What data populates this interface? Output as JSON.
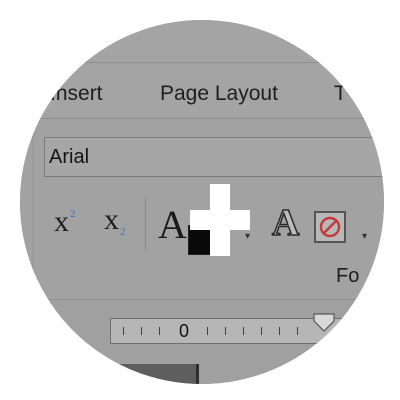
{
  "tabs": {
    "insert": "Insert",
    "page_layout": "Page Layout",
    "next_partial": "T"
  },
  "font": {
    "value": "Arial"
  },
  "icons": {
    "superscript": "x",
    "superscript_mark": "2",
    "subscript": "x",
    "subscript_mark": "2",
    "font_color": "A",
    "text_effect": "A",
    "clear_format": "no-sign-icon",
    "dropdown": "▾"
  },
  "group_label": "Fo",
  "ruler": {
    "zero_label": "0"
  },
  "colors": {
    "accent_blue": "#3a78c8",
    "font_color_swatch": "#0a0a0a"
  }
}
